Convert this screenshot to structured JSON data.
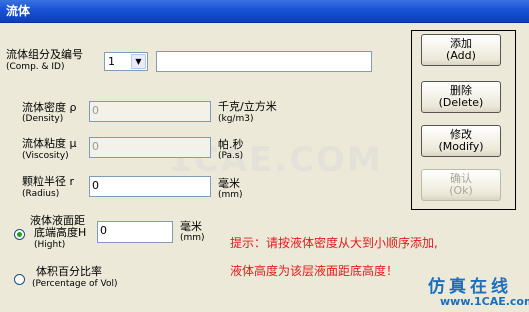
{
  "window": {
    "title": "流体"
  },
  "watermark": "1CAE.COM",
  "comp_id": {
    "label_cn": "流体组分及编号",
    "label_en": "(Comp. & ID)",
    "select_value": "1",
    "text_value": ""
  },
  "density": {
    "label_cn": "流体密度 ρ",
    "label_en": "(Density)",
    "value": "0",
    "unit_cn": "千克/立方米",
    "unit_en": "(kg/m3)"
  },
  "viscosity": {
    "label_cn": "流体粘度 μ",
    "label_en": "(Viscosity)",
    "value": "0",
    "unit_cn": "帕.秒",
    "unit_en": "(Pa.s)"
  },
  "radius": {
    "label_cn": "颗粒半径 r",
    "label_en": "(Radius)",
    "value": "0",
    "unit_cn": "毫米",
    "unit_en": "(mm)"
  },
  "height_option": {
    "label_cn1": "液体液面距",
    "label_cn2": "底端高度H",
    "label_en": "(Hight)",
    "value": "0",
    "unit_cn": "毫米",
    "unit_en": "(mm)",
    "selected": true
  },
  "vol_option": {
    "label_cn": "体积百分比率",
    "label_en": "(Percentage of Vol)",
    "selected": false
  },
  "buttons": {
    "add": {
      "cn": "添加",
      "en": "(Add)"
    },
    "delete": {
      "cn": "删除",
      "en": "(Delete)"
    },
    "modify": {
      "cn": "修改",
      "en": "(Modify)"
    },
    "ok": {
      "cn": "确认",
      "en": "(Ok)"
    }
  },
  "hint": {
    "line1": "提示：请按液体密度从大到小顺序添加,",
    "line2": "液体高度为该层液面距底高度！"
  },
  "logo": {
    "cn": "仿真在线",
    "url": "www.1CAE.com"
  }
}
